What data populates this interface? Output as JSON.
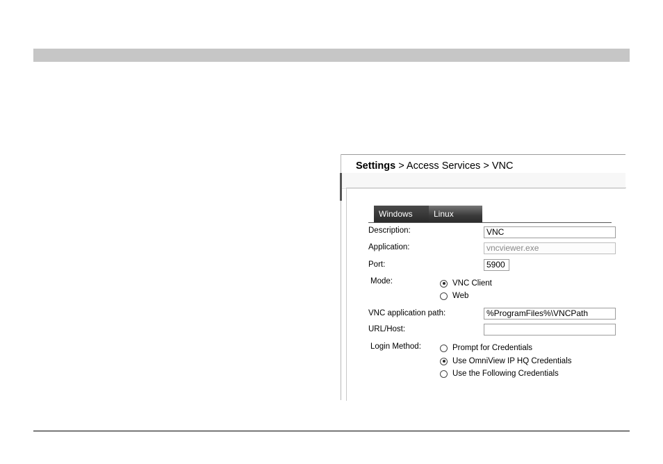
{
  "breadcrumb": {
    "root": "Settings",
    "rest": " > Access Services > VNC"
  },
  "tabs": [
    {
      "label": "Windows"
    },
    {
      "label": "Linux"
    }
  ],
  "form": {
    "description": {
      "label": "Description:",
      "value": "VNC"
    },
    "application": {
      "label": "Application:",
      "value": "vncviewer.exe"
    },
    "port": {
      "label": "Port:",
      "value": "5900"
    },
    "mode": {
      "label": "Mode:",
      "options": [
        {
          "label": "VNC Client",
          "selected": true
        },
        {
          "label": "Web",
          "selected": false
        }
      ]
    },
    "vnc_path": {
      "label": "VNC application path:",
      "value": "%ProgramFiles%\\VNCPath"
    },
    "url_host": {
      "label": "URL/Host:",
      "value": ""
    },
    "login_method": {
      "label": "Login Method:",
      "options": [
        {
          "label": "Prompt for Credentials",
          "selected": false
        },
        {
          "label": "Use OmniView IP HQ Credentials",
          "selected": true
        },
        {
          "label": "Use the Following Credentials",
          "selected": false
        }
      ]
    }
  },
  "colors": {
    "top_bar": "#c6c6c6",
    "tab_dark": "#2a2a2a"
  }
}
